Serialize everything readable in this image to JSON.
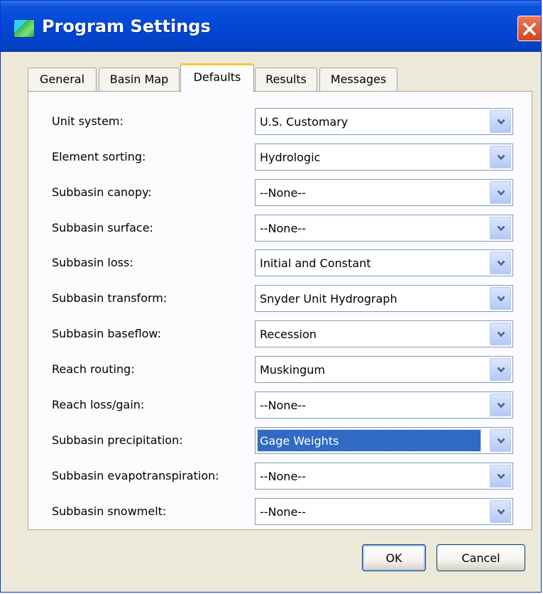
{
  "window": {
    "title": "Program Settings",
    "icon": "program-settings-app-icon",
    "close_icon": "close-icon"
  },
  "tabs": [
    {
      "label": "General",
      "active": false
    },
    {
      "label": "Basin Map",
      "active": false
    },
    {
      "label": "Defaults",
      "active": true
    },
    {
      "label": "Results",
      "active": false
    },
    {
      "label": "Messages",
      "active": false
    }
  ],
  "defaults": [
    {
      "label": "Unit system:",
      "value": "U.S. Customary"
    },
    {
      "label": "Element sorting:",
      "value": "Hydrologic"
    },
    {
      "label": "Subbasin canopy:",
      "value": "--None--"
    },
    {
      "label": "Subbasin surface:",
      "value": "--None--"
    },
    {
      "label": "Subbasin loss:",
      "value": "Initial and Constant"
    },
    {
      "label": "Subbasin transform:",
      "value": "Snyder Unit Hydrograph"
    },
    {
      "label": "Subbasin baseflow:",
      "value": "Recession"
    },
    {
      "label": "Reach routing:",
      "value": "Muskingum"
    },
    {
      "label": "Reach loss/gain:",
      "value": "--None--"
    },
    {
      "label": "Subbasin precipitation:",
      "value": "Gage Weights",
      "focused": true
    },
    {
      "label": "Subbasin evapotranspiration:",
      "value": "--None--"
    },
    {
      "label": "Subbasin snowmelt:",
      "value": "--None--"
    }
  ],
  "buttons": {
    "ok_label": "OK",
    "cancel_label": "Cancel"
  },
  "colors": {
    "titlebar": "#0347d6",
    "close_button": "#d4441f",
    "selection": "#316ac5",
    "active_tab_highlight": "#ffc73c"
  }
}
